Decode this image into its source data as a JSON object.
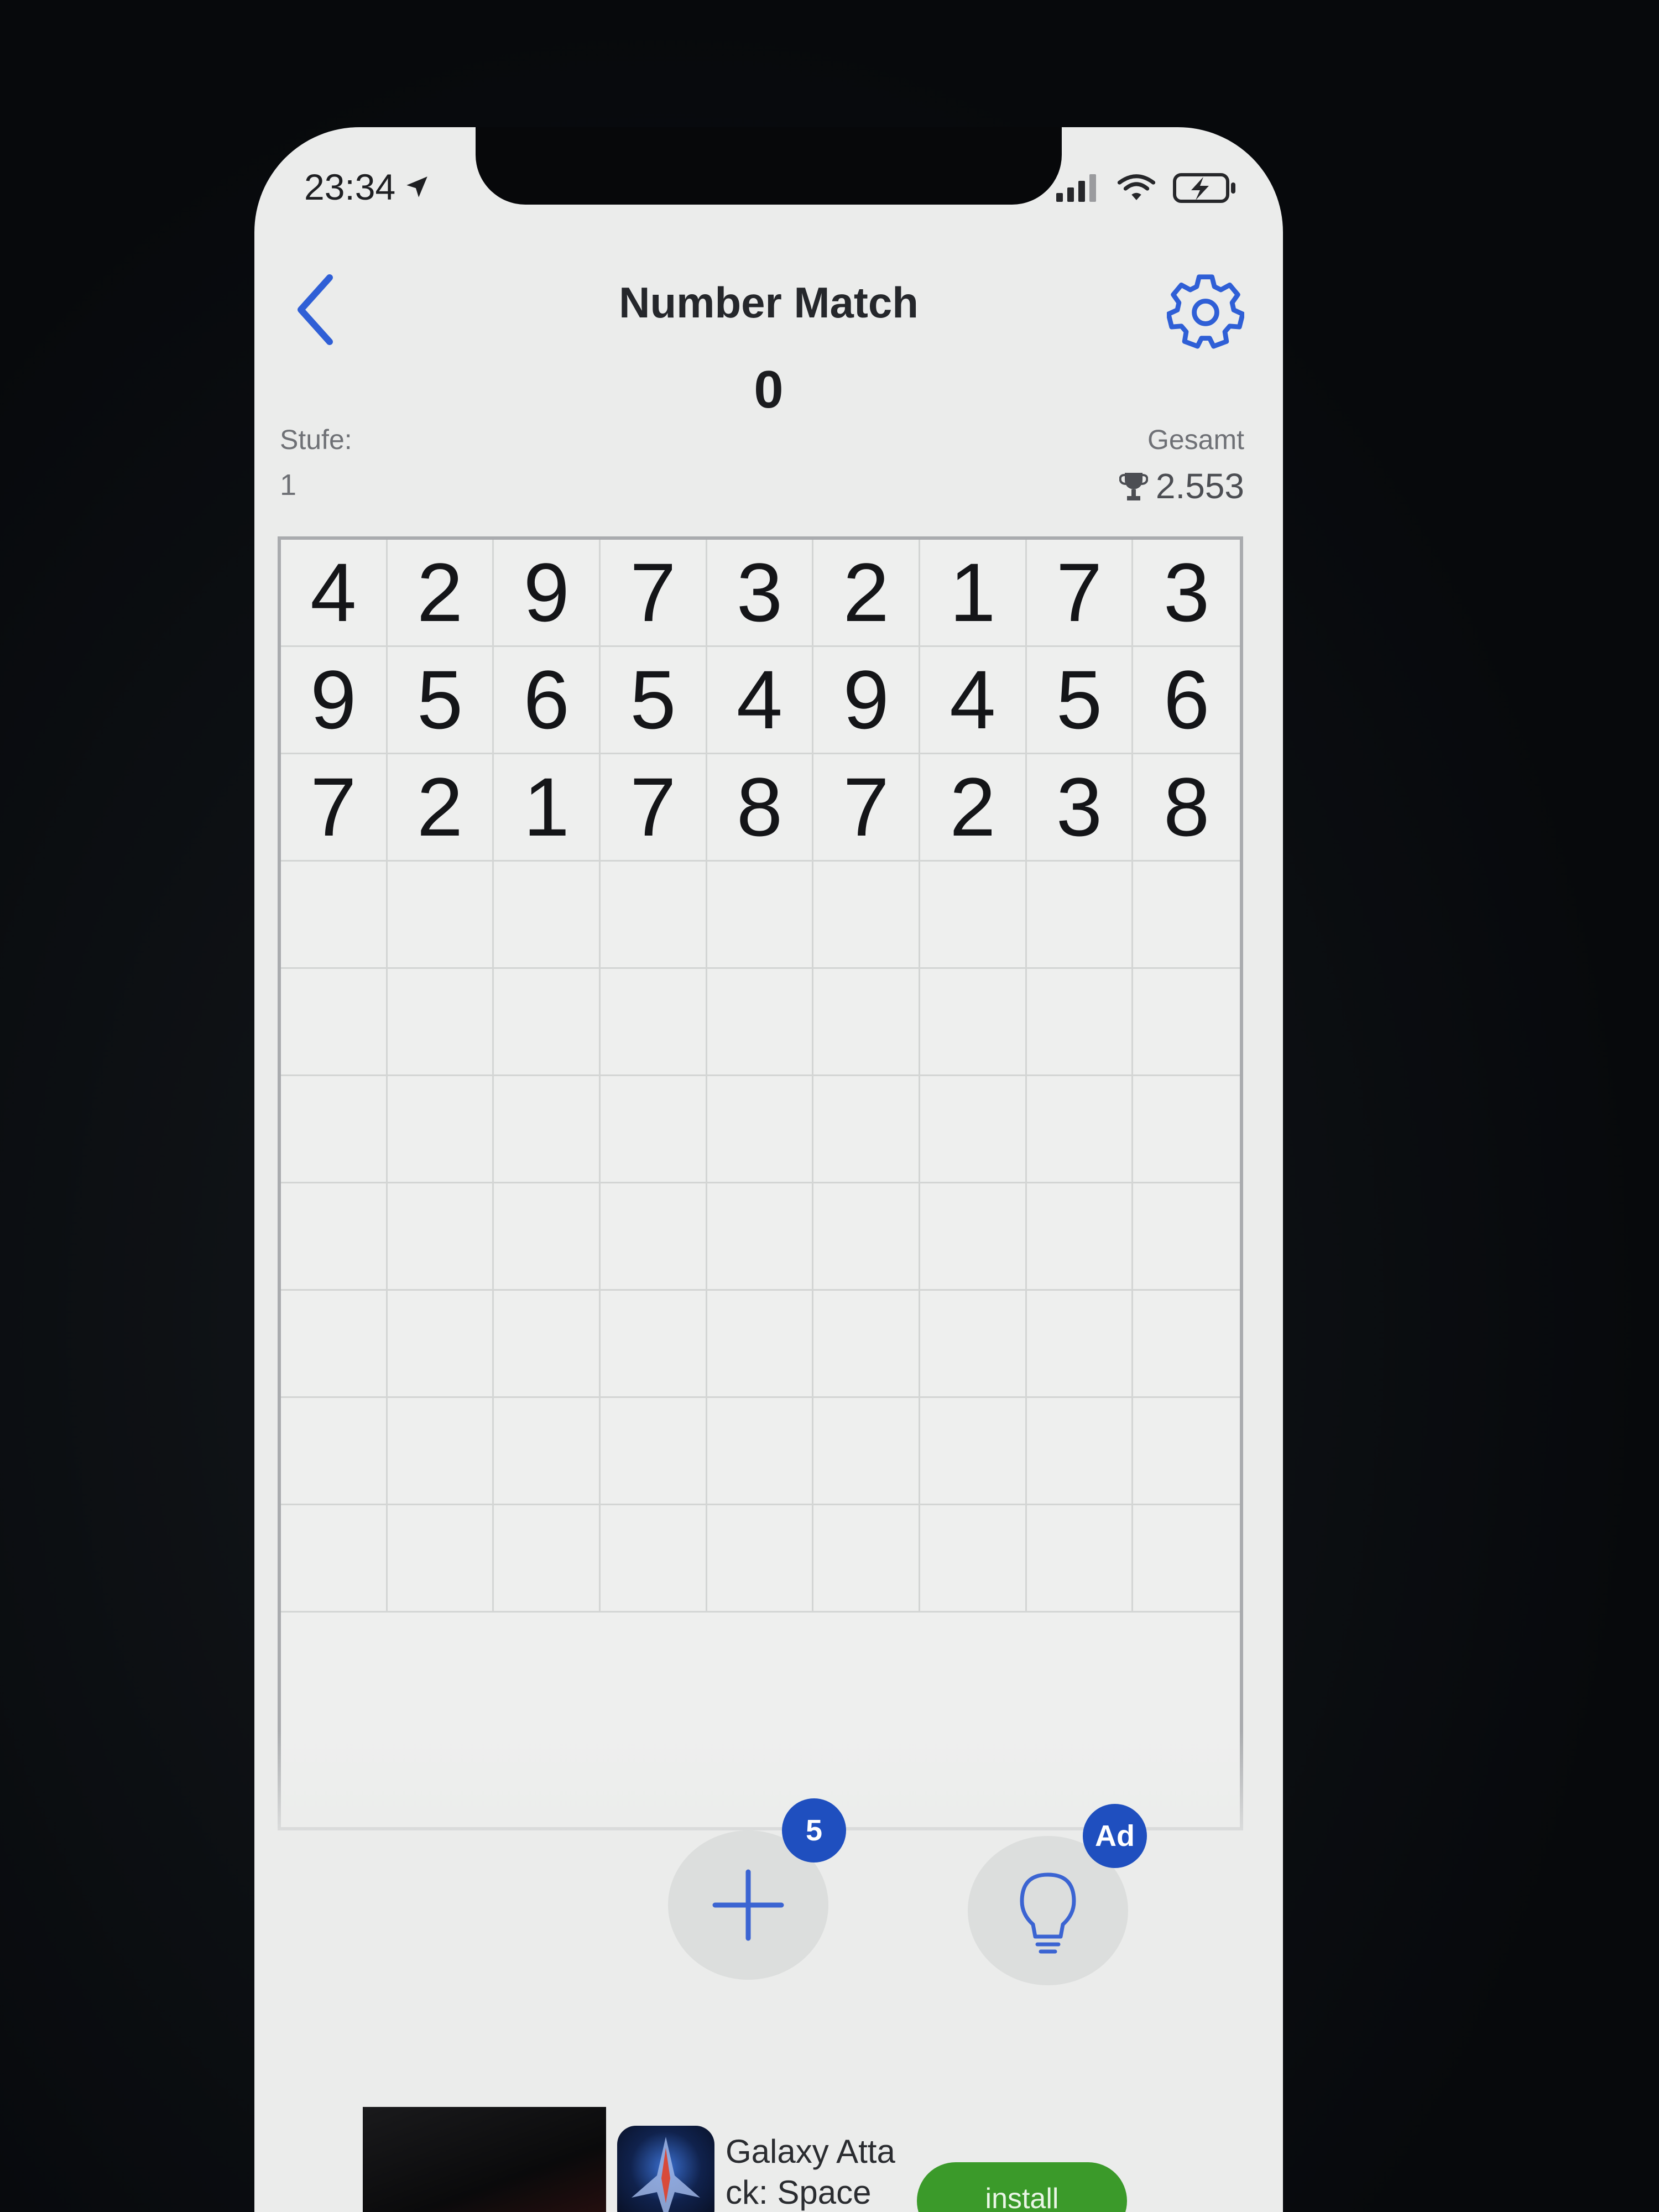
{
  "status_bar": {
    "time": "23:34",
    "icons": [
      "location-arrow-icon",
      "cellular-signal-icon",
      "wifi-icon",
      "battery-charging-icon"
    ]
  },
  "header": {
    "title": "Number Match",
    "back_icon": "chevron-left-icon",
    "settings_icon": "gear-icon",
    "accent_color": "#2f5fd6"
  },
  "score": "0",
  "level": {
    "label": "Stufe:",
    "value": "1"
  },
  "total": {
    "label": "Gesamt",
    "value": "2.553",
    "icon": "trophy-icon"
  },
  "board": {
    "columns": 9,
    "empty_rows": 7,
    "rows": [
      [
        "4",
        "2",
        "9",
        "7",
        "3",
        "2",
        "1",
        "7",
        "3"
      ],
      [
        "9",
        "5",
        "6",
        "5",
        "4",
        "9",
        "4",
        "5",
        "6"
      ],
      [
        "7",
        "2",
        "1",
        "7",
        "8",
        "7",
        "2",
        "3",
        "8"
      ]
    ]
  },
  "actions": {
    "add": {
      "icon": "plus-icon",
      "badge": "5"
    },
    "hint": {
      "icon": "lightbulb-icon",
      "badge": "Ad"
    },
    "badge_color": "#1f4fbf"
  },
  "ad": {
    "title": "Galaxy Atta ck: Space",
    "install_label": "install",
    "install_color": "#3b9a2a"
  }
}
